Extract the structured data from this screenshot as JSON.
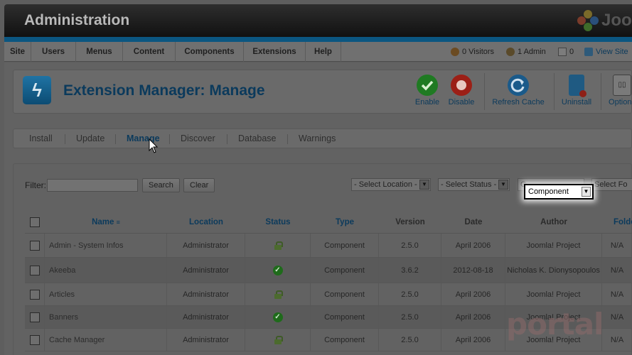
{
  "header": {
    "title": "Administration",
    "logo_text": "Joo"
  },
  "menubar": {
    "items": [
      "Site",
      "Users",
      "Menus",
      "Content",
      "Components",
      "Extensions",
      "Help"
    ],
    "status": {
      "visitors": "0 Visitors",
      "admins": "1 Admin",
      "messages": "0",
      "view_site": "View Site"
    }
  },
  "toolbar": {
    "page_icon_glyph": "ϟ",
    "title": "Extension Manager: Manage",
    "buttons": [
      "Enable",
      "Disable",
      "Refresh Cache",
      "Uninstall",
      "Options"
    ]
  },
  "subtabs": [
    "Install",
    "Update",
    "Manage",
    "Discover",
    "Database",
    "Warnings"
  ],
  "filter": {
    "label": "Filter:",
    "search_value": "",
    "search_button": "Search",
    "clear_button": "Clear",
    "location_select": "- Select Location -",
    "status_select": "- Select Status -",
    "type_stub": "C",
    "folder_stub": "Select Fo",
    "type_dropdown_value": "Component"
  },
  "table": {
    "headers": [
      "Name",
      "Location",
      "Status",
      "Type",
      "Version",
      "Date",
      "Author",
      "Folde"
    ],
    "rows": [
      {
        "name": "Admin - System Infos",
        "location": "Administrator",
        "status": "lock",
        "type": "Component",
        "version": "2.5.0",
        "date": "April 2006",
        "author": "Joomla! Project",
        "folder": "N/A"
      },
      {
        "name": "Akeeba",
        "location": "Administrator",
        "status": "ok",
        "type": "Component",
        "version": "3.6.2",
        "date": "2012-08-18",
        "author": "Nicholas K. Dionysopoulos",
        "folder": "N/A"
      },
      {
        "name": "Articles",
        "location": "Administrator",
        "status": "lock",
        "type": "Component",
        "version": "2.5.0",
        "date": "April 2006",
        "author": "Joomla! Project",
        "folder": "N/A"
      },
      {
        "name": "Banners",
        "location": "Administrator",
        "status": "ok",
        "type": "Component",
        "version": "2.5.0",
        "date": "April 2006",
        "author": "Joomla! Project",
        "folder": "N/A"
      },
      {
        "name": "Cache Manager",
        "location": "Administrator",
        "status": "lock",
        "type": "Component",
        "version": "2.5.0",
        "date": "April 2006",
        "author": "Joomla! Project",
        "folder": "N/A"
      }
    ]
  },
  "watermark": "portal",
  "colors": {
    "accent": "#0b3a5c",
    "header_strip": "#0b5681",
    "enable": "#1f9a2a",
    "disable": "#c9261c"
  }
}
